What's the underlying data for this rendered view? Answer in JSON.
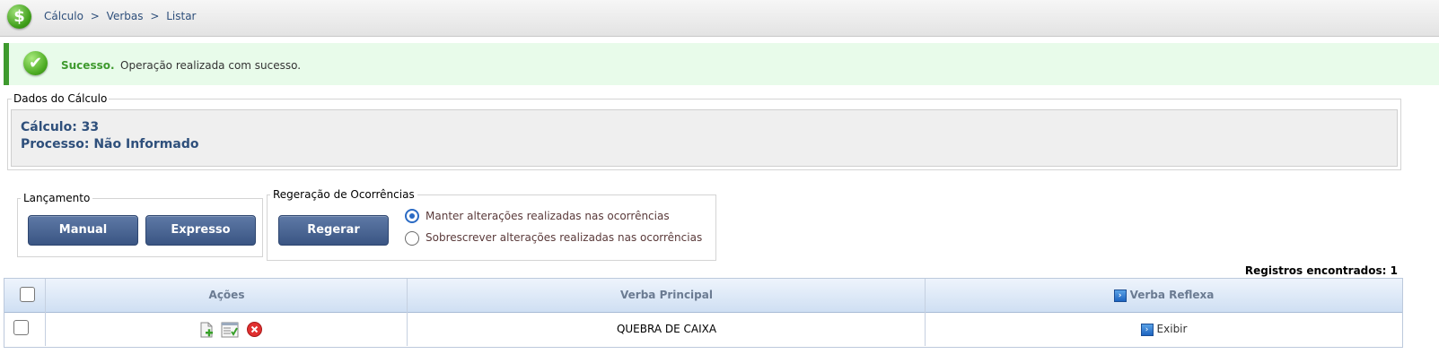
{
  "header": {
    "logo_symbol": "$",
    "breadcrumb": [
      "Cálculo",
      "Verbas",
      "Listar"
    ],
    "separator": ">"
  },
  "message": {
    "title": "Sucesso.",
    "text": "Operação realizada com sucesso.",
    "color": "#3e9a2e"
  },
  "dados": {
    "legend": "Dados do Cálculo",
    "calculo": "Cálculo: 33",
    "processo": "Processo: Não Informado"
  },
  "lancamento": {
    "legend": "Lançamento",
    "manual_label": "Manual",
    "expresso_label": "Expresso"
  },
  "regeracao": {
    "legend": "Regeração de Ocorrências",
    "regerar_label": "Regerar",
    "options": [
      {
        "label": "Manter alterações realizadas nas ocorrências",
        "checked": true
      },
      {
        "label": "Sobrescrever alterações realizadas nas ocorrências",
        "checked": false
      }
    ]
  },
  "registros": "Registros encontrados: 1",
  "table": {
    "headers": {
      "acoes": "Ações",
      "verba_principal": "Verba Principal",
      "verba_reflexa": "Verba Reflexa"
    },
    "rows": [
      {
        "verba_principal": "QUEBRA DE CAIXA",
        "verba_reflexa_link": "Exibir",
        "checked": false
      }
    ]
  },
  "icons": {
    "arrow_glyph": "›",
    "check_glyph": "✔",
    "delete_glyph": "✕"
  }
}
